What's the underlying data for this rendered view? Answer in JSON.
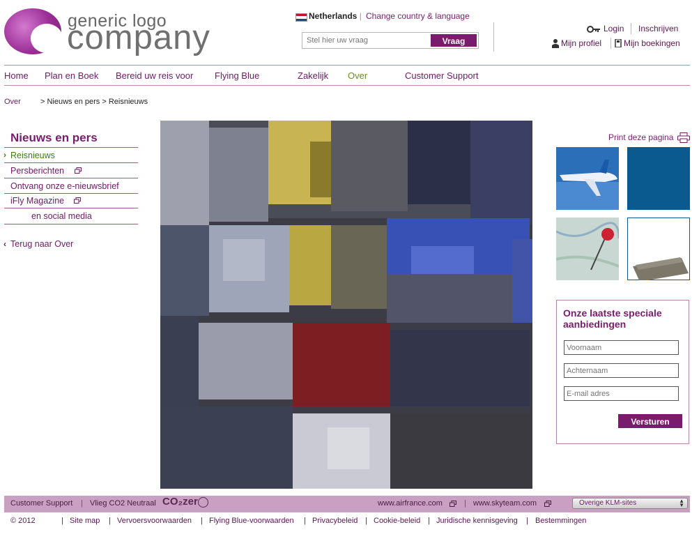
{
  "logo": {
    "small": "generic logo",
    "big": "company"
  },
  "header": {
    "country": "Netherlands",
    "separator": "|",
    "change_lang": "Change country & language",
    "search_placeholder": "Stel hier uw vraag",
    "search_button": "Vraag",
    "login": "Login",
    "register": "Inschrijven",
    "profile": "Mijn profiel",
    "bookings": "Mijn boekingen"
  },
  "nav": [
    {
      "label": "Home"
    },
    {
      "label": "Plan en Boek"
    },
    {
      "label": "Bereid uw reis voor"
    },
    {
      "label": "Flying Blue"
    },
    {
      "label": "Zakelijk"
    },
    {
      "label": "Over"
    },
    {
      "label": "Customer Support"
    }
  ],
  "breadcrumb": {
    "root": "Over",
    "rest": "> Nieuws en pers > Reisnieuws"
  },
  "sidebar": {
    "title": "Nieuws en pers",
    "items": [
      {
        "label": "Reisnieuws"
      },
      {
        "label": "Persberichten"
      },
      {
        "label": "Ontvang onze e-nieuwsbrief"
      },
      {
        "label": "iFly Magazine"
      },
      {
        "label": "en social media"
      }
    ],
    "back": "Terug naar Over"
  },
  "right": {
    "print": "Print deze pagina",
    "offers_title": "Onze laatste speciale aanbiedingen",
    "firstname": "Voornaam",
    "lastname": "Achternaam",
    "email": "E-mail adres",
    "submit": "Versturen"
  },
  "footer": {
    "support": "Customer Support",
    "co2": "Vlieg CO2 Neutraal",
    "co2_logo": "CO₂zer",
    "airfrance": "www.airfrance.com",
    "skyteam": "www.skyteam.com",
    "other_sites": "Overige KLM-sites",
    "copyright": "© 2012",
    "links": [
      "Site map",
      "Vervoersvoorwaarden",
      "Flying Blue-voorwaarden",
      "Privacybeleid",
      "Cookie-beleid",
      "Juridische kennisgeving",
      "Bestemmingen"
    ]
  },
  "colors": {
    "brand": "#7a1c6e",
    "active_nav": "#6b8e23",
    "footer_bar": "#c9a0c1",
    "thumb_blue": "#0b5a8f"
  }
}
